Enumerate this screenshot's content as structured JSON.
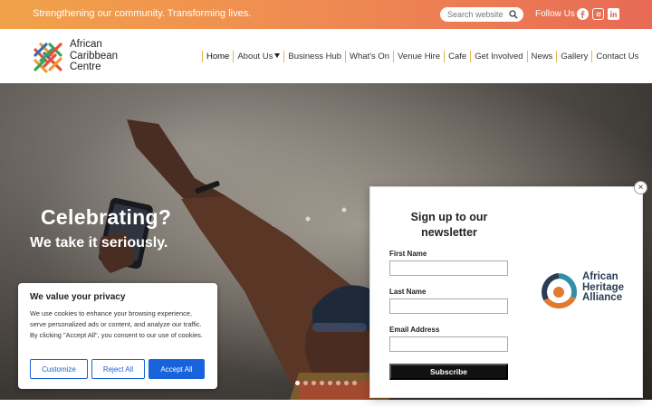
{
  "topbar": {
    "tagline": "Strengthening our community. Transforming lives.",
    "search_placeholder": "Search website",
    "follow_label": "Follow Us",
    "social": [
      "facebook-icon",
      "instagram-icon",
      "linkedin-icon"
    ]
  },
  "logo": {
    "line1": "African",
    "line2": "Caribbean",
    "line3": "Centre"
  },
  "nav": {
    "items": [
      "Home",
      "About Us",
      "Business Hub",
      "What's On",
      "Venue Hire",
      "Cafe",
      "Get Involved",
      "News",
      "Gallery",
      "Contact Us"
    ],
    "active": "Home"
  },
  "hero": {
    "title": "Celebrating?",
    "subtitle": "We take it seriously.",
    "slides_total": 8,
    "slide_active": 1
  },
  "cookie": {
    "title": "We value your privacy",
    "body": "We use cookies to enhance your browsing experience, serve personalized ads or content, and analyze our traffic. By clicking \"Accept All\", you consent to our use of cookies.",
    "customize": "Customize",
    "reject": "Reject All",
    "accept": "Accept All"
  },
  "newsletter": {
    "title": "Sign up to our newsletter",
    "first_name_label": "First Name",
    "last_name_label": "Last Name",
    "email_label": "Email Address",
    "subscribe": "Subscribe",
    "close": "×",
    "partner_line1": "African",
    "partner_line2": "Heritage",
    "partner_line3": "Alliance"
  },
  "colors": {
    "accent": "#e86a55",
    "brand_orange": "#f0a24a",
    "cookie_blue": "#1863dc"
  }
}
